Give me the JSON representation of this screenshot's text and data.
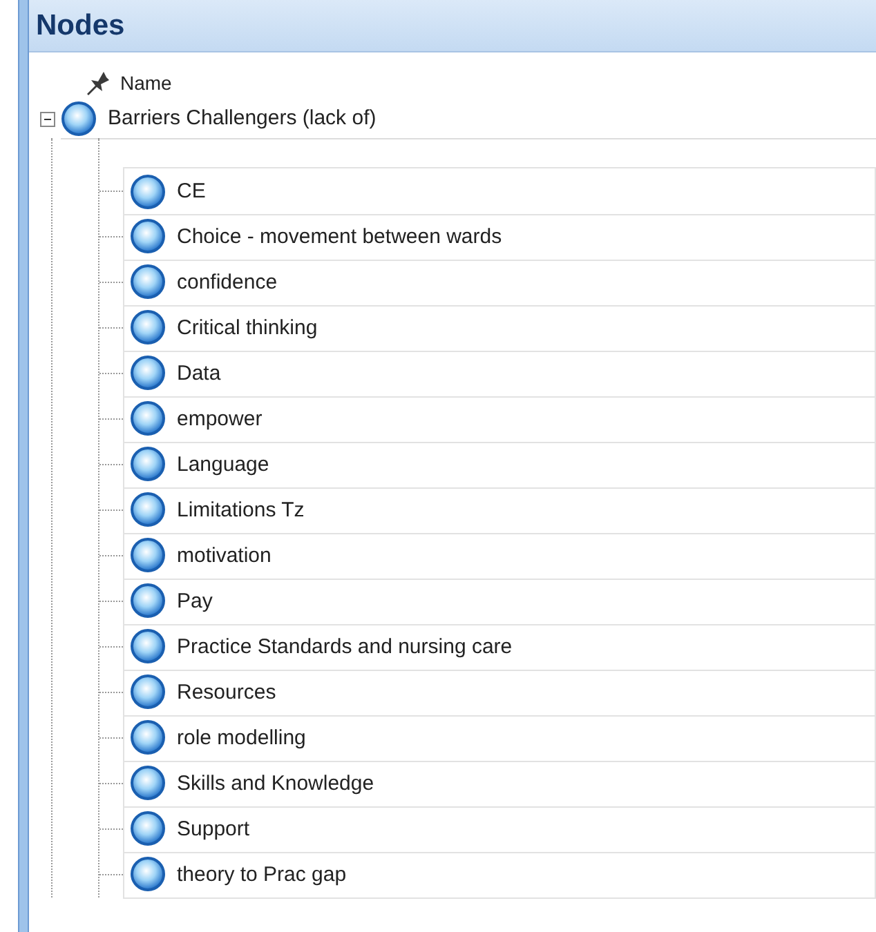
{
  "panel": {
    "title": "Nodes"
  },
  "columns": [
    {
      "label": "Name"
    }
  ],
  "tree": [
    {
      "label": "Barriers Challengers (lack of)",
      "expanded": true,
      "children": [
        {
          "label": "CE"
        },
        {
          "label": "Choice - movement between wards"
        },
        {
          "label": "confidence"
        },
        {
          "label": "Critical thinking"
        },
        {
          "label": "Data"
        },
        {
          "label": "empower"
        },
        {
          "label": "Language"
        },
        {
          "label": "Limitations Tz"
        },
        {
          "label": "motivation"
        },
        {
          "label": "Pay"
        },
        {
          "label": "Practice Standards and nursing care"
        },
        {
          "label": "Resources"
        },
        {
          "label": "role modelling"
        },
        {
          "label": "Skills and Knowledge"
        },
        {
          "label": "Support"
        },
        {
          "label": "theory to Prac gap"
        }
      ]
    }
  ]
}
